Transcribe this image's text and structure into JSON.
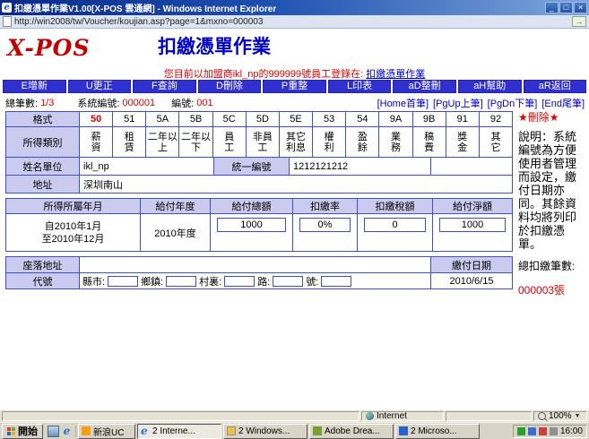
{
  "colors": {
    "accent_blue": "#3030D0",
    "grid_blue": "#3A52C4",
    "label_lavender": "#CBCBF0",
    "brand_red": "#C00000",
    "value_red": "#E00000",
    "title_blue": "#0000C0"
  },
  "window": {
    "title": "扣繳憑單作業V1.00[X-POS 雲通網] - Windows Internet Explorer",
    "url": "http://win2008/tw/Voucher/koujian.asp?page=1&mxno=000003",
    "controls": {
      "minimize": "_",
      "maximize": "□",
      "close": "×"
    },
    "go_icon": "→"
  },
  "header": {
    "logo": "X-POS",
    "title": "扣繳憑單作業",
    "login_prefix": "您目前以加盟商ikl_np的999999號員工登錄在: ",
    "login_page": "扣繳憑單作業"
  },
  "toolbar": {
    "buttons": [
      "E增新",
      "U更正",
      "F查詢",
      "D刪除",
      "P重整",
      "L印表",
      "aD整刪",
      "aH幫助",
      "aR返回"
    ]
  },
  "recordbar": {
    "total_label": "總筆數:",
    "total_value": "1/3",
    "sys_label": "系統編號:",
    "sys_value": "000001",
    "no_label": "編號:",
    "no_value": "001",
    "nav_home": "[Home首筆]",
    "nav_prev": "[PgUp上筆]",
    "nav_next": "[PgDn下筆]",
    "nav_end": "[End尾筆]"
  },
  "form": {
    "format_label": "格式",
    "formats": [
      "50",
      "51",
      "5A",
      "5B",
      "5C",
      "5D",
      "5E",
      "53",
      "54",
      "9A",
      "9B",
      "91",
      "92"
    ],
    "category_label": "所得類別",
    "categories": [
      "薪\n資",
      "租\n賃",
      "二年以\n上",
      "二年以\n下",
      "員\n工",
      "非員\n工",
      "其它\n利息",
      "權\n利",
      "盈\n餘",
      "業\n務",
      "稿\n費",
      "獎\n金",
      "其\n它"
    ],
    "name_label": "姓名單位",
    "name_value": "ikl_np",
    "uniform_label": "統一編號",
    "uniform_value": "1212121212",
    "address_label": "地址",
    "address_value": "深圳南山",
    "table_headers": [
      "所得所屬年月",
      "給付年度",
      "給付總額",
      "扣繳率",
      "扣繳稅額",
      "給付淨額"
    ],
    "period_line1": "自2010年1月",
    "period_line2": "至2010年12月",
    "pay_year": "2010年度",
    "pay_total": "1000",
    "rate": "0%",
    "tax": "0",
    "net": "1000",
    "location_label": "座落地址",
    "code_label": "代號",
    "code_fields": [
      "縣市:",
      "鄉鎮:",
      "村裏:",
      "路:",
      "號:"
    ],
    "paydate_label": "繳付日期",
    "paydate_value": "2010/6/15"
  },
  "sidebar": {
    "delete": "★刪除★",
    "description": "說明：系統編號為方便使用者管理而設定，繳付日期亦同。其餘資料均將列印於扣繳憑單。",
    "total_label": "總扣繳筆數:",
    "total_value": "000003張"
  },
  "statusbar": {
    "zone": "Internet",
    "zoom": "100%",
    "zoom_arrow": "▼"
  },
  "taskbar": {
    "start": "開始",
    "tasks": [
      "新浪UC",
      "2 Interne...",
      "2 Windows...",
      "Adobe Drea...",
      "2 Microso..."
    ],
    "time": "16:00",
    "ie_glyph": "e"
  }
}
